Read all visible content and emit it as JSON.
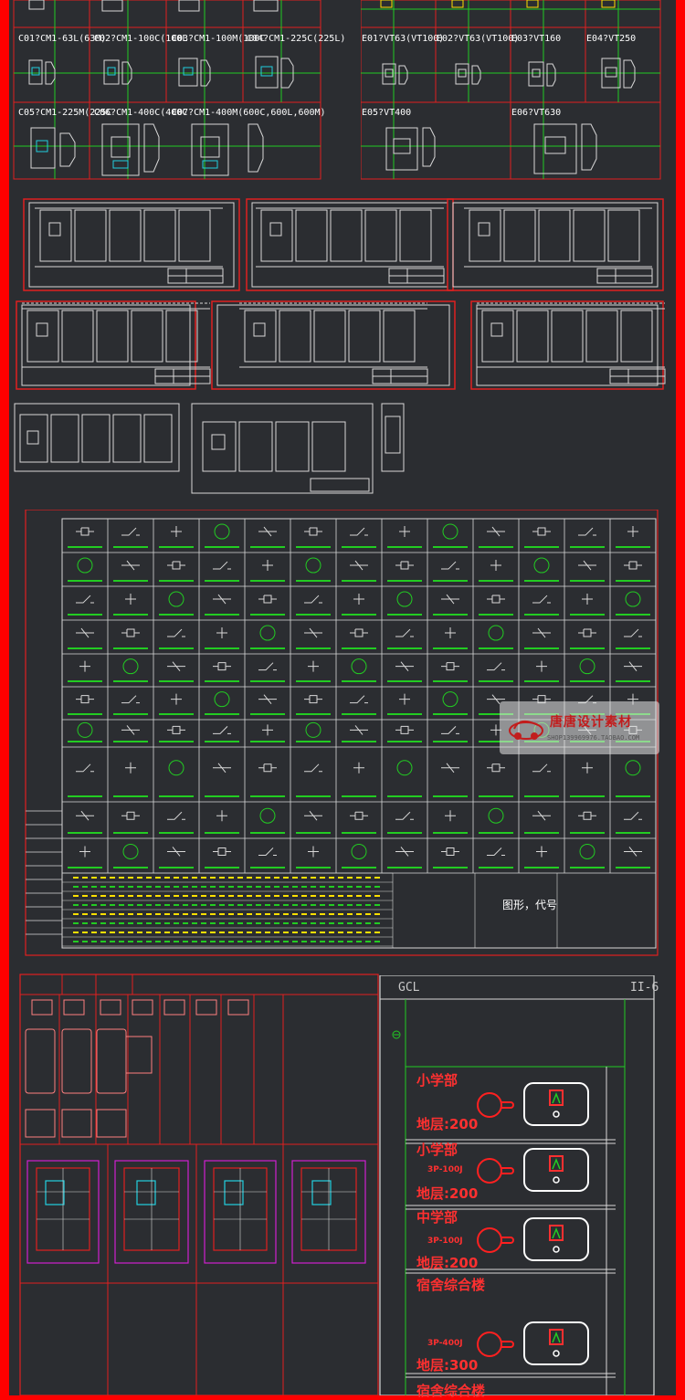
{
  "colors": {
    "background": "#2b2d31",
    "border": "#ff0000",
    "line_red": "#e02020",
    "line_white": "#d8d8d8",
    "line_green": "#22cc22",
    "accent_yellow": "#ffe000",
    "accent_cyan": "#22d0e0"
  },
  "breakers_left": {
    "row1": [
      "C01?CM1-63L(63M)",
      "C02?CM1-100C(100L",
      "C03?CM1-100M(100C",
      "C04?CM1-225C(225L)"
    ],
    "row2": [
      "C05?CM1-225M(225C",
      "C06?CM1-400C(400C",
      "C07?CM1-400M(600C,600L,600M)"
    ]
  },
  "breakers_right": {
    "row1": [
      "E01?VT63(VT100)",
      "E02?VT63(VT100)",
      "E03?VT160",
      "E04?VT250"
    ],
    "row2": [
      "E05?VT400",
      "E06?VT630"
    ]
  },
  "legend": {
    "title": "图形，代号"
  },
  "watermark": {
    "title": "唐唐设计素材",
    "subtitle": "SHOP139969976.TAOBAO.COM"
  },
  "gcl_panel": {
    "header_left": "GCL",
    "header_right": "II-6",
    "entries": [
      {
        "title": "小学部",
        "sub": "",
        "area": "地层:200"
      },
      {
        "title": "小学部",
        "sub": "3P-100J",
        "area": "地层:200"
      },
      {
        "title": "中学部",
        "sub": "3P-100J",
        "area": "地层:200"
      },
      {
        "title": "宿舍综合楼",
        "sub": "3P-400J",
        "area": "地层:300"
      },
      {
        "title": "宿舍综合楼",
        "sub": "",
        "area": ""
      }
    ]
  }
}
